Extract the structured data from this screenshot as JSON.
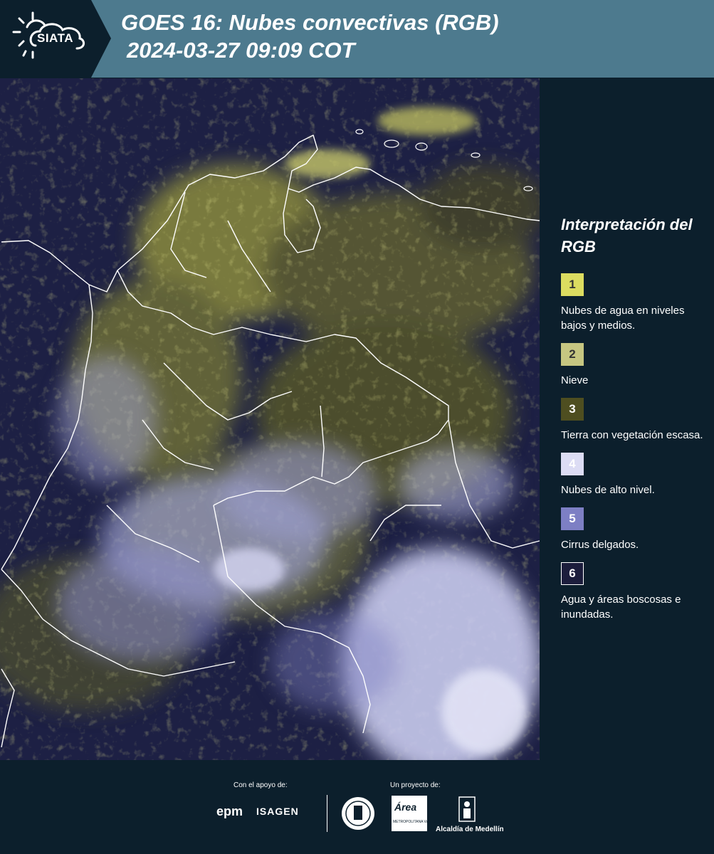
{
  "header": {
    "logo_text": "SIATA",
    "title_line1": "GOES 16: Nubes convectivas (RGB)",
    "title_line2": "2024-03-27 09:09 COT",
    "background_color": "#4d7a8e",
    "logo_panel_color": "#0c1f2c"
  },
  "map": {
    "description_icon": "satellite-rgb-image",
    "colors": {
      "background": "#1d2044",
      "low_clouds": "#d6d65a",
      "high_clouds": "#c9cbee",
      "cirrus": "#8d8ecb",
      "borders": "#ffffff"
    }
  },
  "legend": {
    "title": "Interpretación del RGB",
    "items": [
      {
        "number": "1",
        "label": "Nubes de agua en niveles bajos y medios.",
        "color": "#dcdc60",
        "text_color": "#333333"
      },
      {
        "number": "2",
        "label": "Nieve",
        "color": "#c6c681",
        "text_color": "#333333"
      },
      {
        "number": "3",
        "label": "Tierra con vegetación escasa.",
        "color": "#4e4e20",
        "text_color": "#ffffff"
      },
      {
        "number": "4",
        "label": "Nubes de alto nivel.",
        "color": "#dcdcf4",
        "text_color": "#ffffff"
      },
      {
        "number": "5",
        "label": "Cirrus delgados.",
        "color": "#7d7fc4",
        "text_color": "#ffffff"
      },
      {
        "number": "6",
        "label": "Agua y áreas boscosas e inundadas.",
        "color": "#1c1d3c",
        "text_color": "#ffffff"
      }
    ]
  },
  "footer": {
    "support_label": "Con el apoyo de:",
    "project_label": "Un proyecto de:",
    "epm": "epm",
    "isagen": "ISAGEN",
    "area_logo": "Área",
    "area_sub": "METROPOLITANA Valle de Aburrá",
    "alcaldia": "Alcaldía de Medellín"
  }
}
